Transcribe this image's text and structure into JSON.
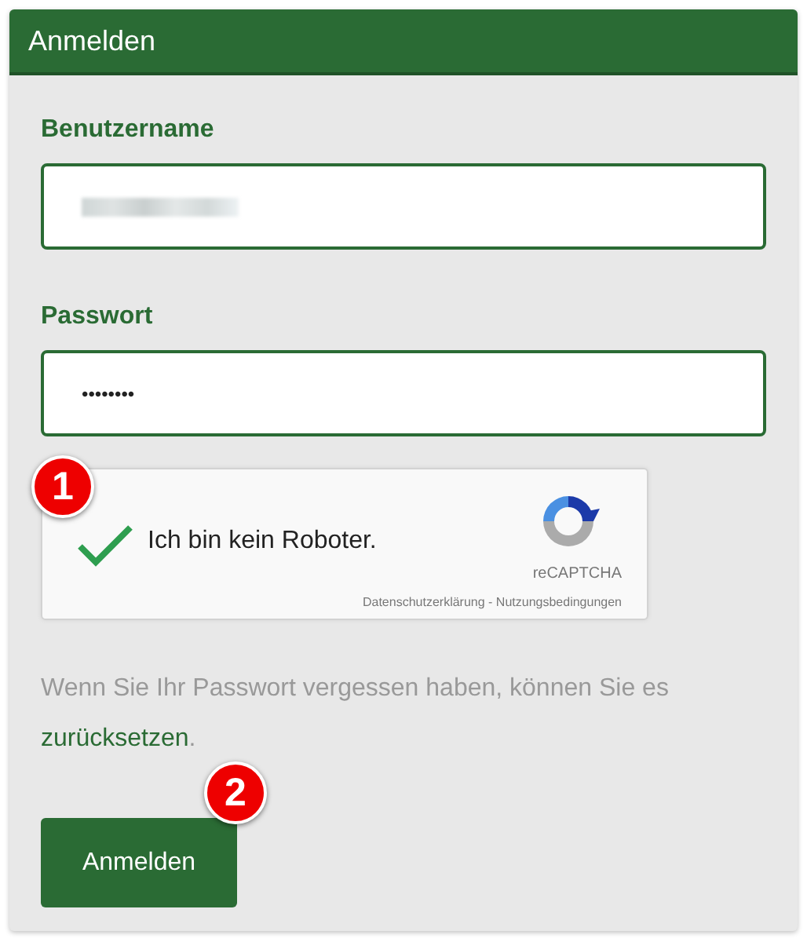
{
  "panel": {
    "title": "Anmelden"
  },
  "username": {
    "label": "Benutzername",
    "redacted": true
  },
  "password": {
    "label": "Passwort",
    "value": "••••••••"
  },
  "captcha": {
    "checked": true,
    "label": "Ich bin kein Roboter.",
    "brand": "reCAPTCHA",
    "privacy_link": "Datenschutzerklärung",
    "separator": " - ",
    "terms_link": "Nutzungsbedingungen"
  },
  "reset_note": {
    "text": "Wenn Sie Ihr Passwort vergessen haben, können Sie es ",
    "link": "zurücksetzen",
    "end": "."
  },
  "submit": {
    "label": "Anmelden"
  },
  "markers": [
    "1",
    "2"
  ]
}
